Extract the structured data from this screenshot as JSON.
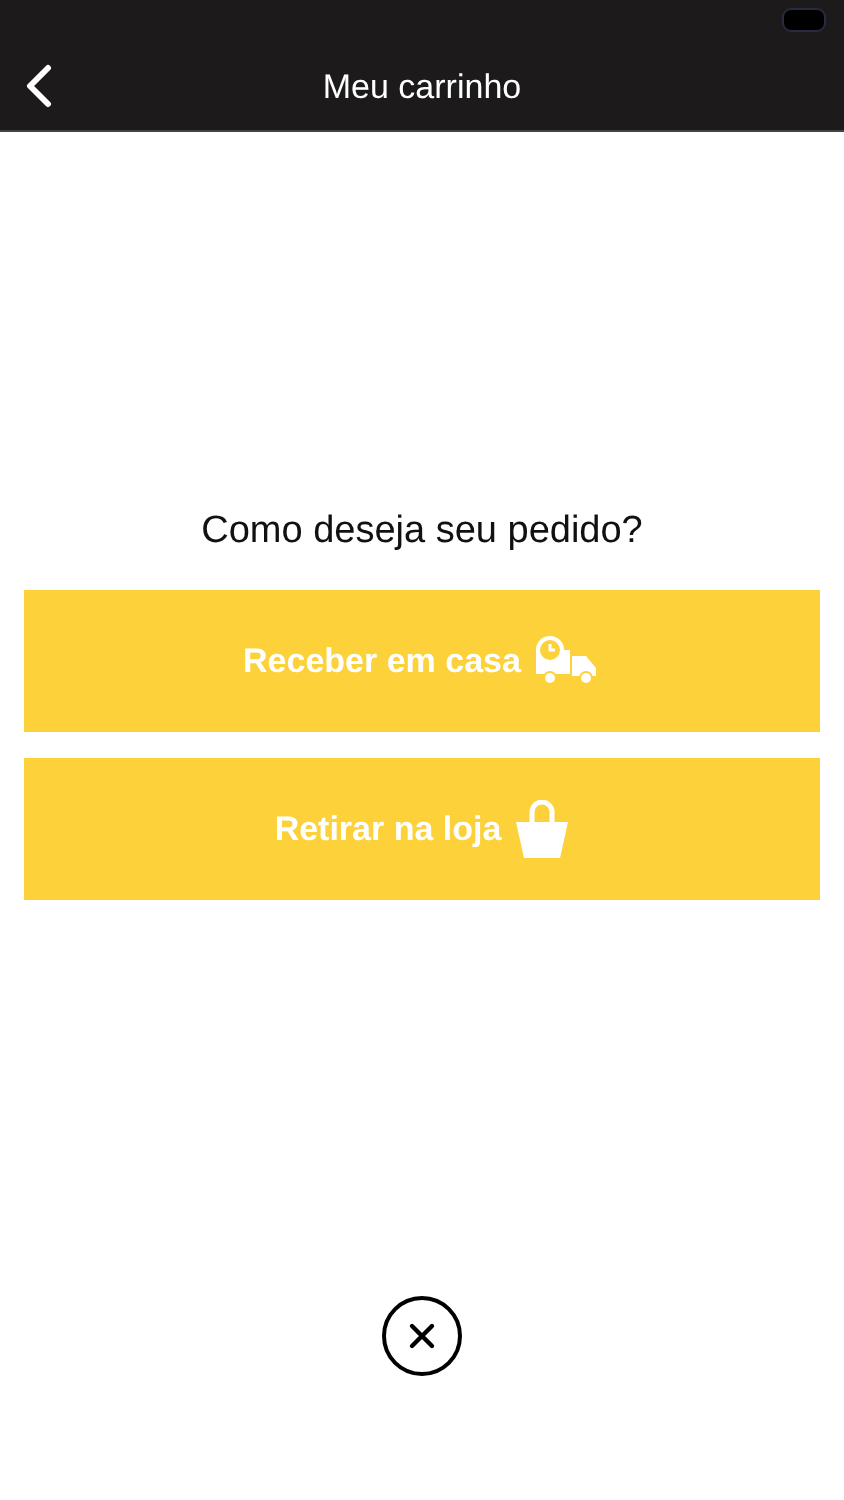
{
  "header": {
    "title": "Meu carrinho"
  },
  "question": "Como deseja seu pedido?",
  "options": [
    {
      "kind": "delivery",
      "label": "Receber em casa"
    },
    {
      "kind": "pickup",
      "label": "Retirar na loja"
    }
  ]
}
